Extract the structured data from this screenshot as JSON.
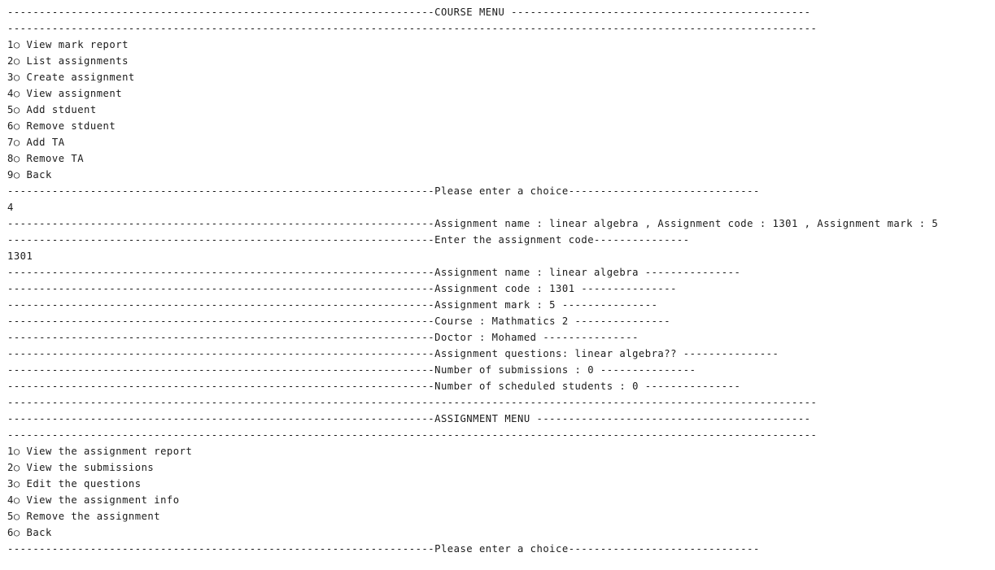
{
  "console": {
    "lines": [
      "-------------------------------------------------------------------COURSE MENU -----------------------------------------------",
      "-------------------------------------------------------------------------------------------------------------------------------",
      "1○ View mark report",
      "2○ List assignments",
      "3○ Create assignment",
      "4○ View assignment",
      "5○ Add stduent",
      "6○ Remove stduent",
      "7○ Add TA",
      "8○ Remove TA",
      "9○ Back",
      "-------------------------------------------------------------------Please enter a choice------------------------------",
      "4",
      "-------------------------------------------------------------------Assignment name : linear algebra , Assignment code : 1301 , Assignment mark : 5",
      "-------------------------------------------------------------------Enter the assignment code---------------",
      "1301",
      "-------------------------------------------------------------------Assignment name : linear algebra ---------------",
      "-------------------------------------------------------------------Assignment code : 1301 ---------------",
      "-------------------------------------------------------------------Assignment mark : 5 ---------------",
      "-------------------------------------------------------------------Course : Mathmatics 2 ---------------",
      "-------------------------------------------------------------------Doctor : Mohamed ---------------",
      "-------------------------------------------------------------------Assignment questions: linear algebra?? ---------------",
      "-------------------------------------------------------------------Number of submissions : 0 ---------------",
      "-------------------------------------------------------------------Number of scheduled students : 0 ---------------",
      "-------------------------------------------------------------------------------------------------------------------------------",
      "-------------------------------------------------------------------ASSIGNMENT MENU -------------------------------------------",
      "-------------------------------------------------------------------------------------------------------------------------------",
      "1○ View the assignment report",
      "2○ View the submissions",
      "3○ Edit the questions",
      "4○ View the assignment info",
      "5○ Remove the assignment",
      "6○ Back",
      "-------------------------------------------------------------------Please enter a choice------------------------------"
    ]
  }
}
